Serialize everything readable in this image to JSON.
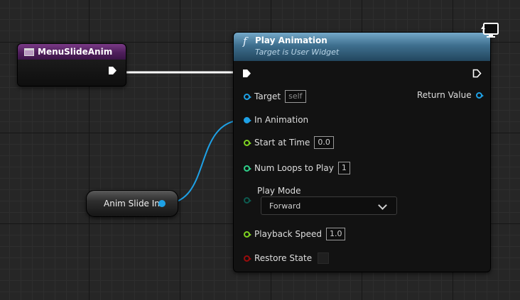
{
  "variable_node": {
    "title": "MenuSlideAnim"
  },
  "slide_node": {
    "label": "Anim Slide In"
  },
  "function_node": {
    "icon": "f",
    "title": "Play Animation",
    "subtitle": "Target is User Widget",
    "return_label": "Return Value",
    "pins": {
      "target": {
        "label": "Target",
        "value": "self"
      },
      "in_animation": {
        "label": "In Animation"
      },
      "start_at_time": {
        "label": "Start at Time",
        "value": "0.0"
      },
      "num_loops": {
        "label": "Num Loops to Play",
        "value": "1"
      },
      "play_mode": {
        "label": "Play Mode",
        "value": "Forward"
      },
      "playback_speed": {
        "label": "Playback Speed",
        "value": "1.0"
      },
      "restore_state": {
        "label": "Restore State"
      }
    }
  },
  "colors": {
    "object_pin": "#1ea1e6",
    "float_pin": "#7ed321",
    "int_pin": "#2fcf8a",
    "enum_pin": "#0d5a4f",
    "bool_pin": "#9a0c0c",
    "exec_wire": "#ffffff",
    "function_header": "#3e6f8e",
    "variable_header": "#4f1f5c"
  }
}
